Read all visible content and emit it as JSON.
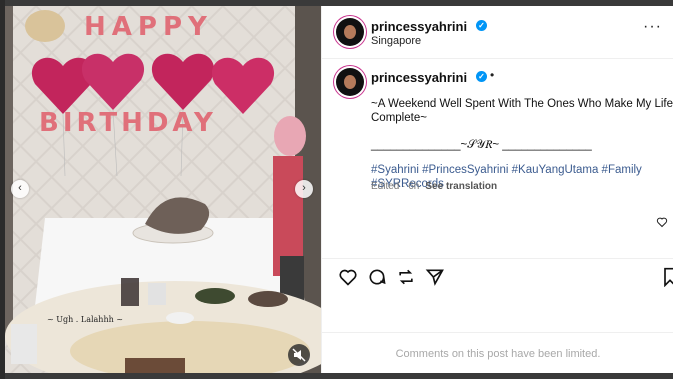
{
  "post": {
    "username": "princessyahrini",
    "location": "Singapore",
    "caption_line1": "~A Weekend Well Spent With The Ones Who Make My Life",
    "caption_line2": "Complete~",
    "caption_signature": "______________~𝒮𝒴𝑅~ ______________",
    "hashtags": "#Syahrini #PrincesSyahrini #KauYangUtama #Family #SYRRecords",
    "edited": "Edited · 6h",
    "see_translation": "See translation",
    "comments_limited": "Comments on this post have been limited."
  },
  "video": {
    "banner_happy": "HAPPY",
    "balloon_text": "",
    "banner_birthday": "BIRTHDAY",
    "subtitle": "~ Ugh . Lalahhh ~"
  },
  "icons": {
    "more": "more-horizontal-icon",
    "like": "heart-icon",
    "comment": "comment-icon",
    "share": "repost-icon",
    "send": "send-icon",
    "save": "bookmark-icon",
    "mute": "mute-icon"
  },
  "colors": {
    "verified": "#0095f6",
    "hashtag": "#3b5b8f",
    "balloon": "#c2255c"
  }
}
